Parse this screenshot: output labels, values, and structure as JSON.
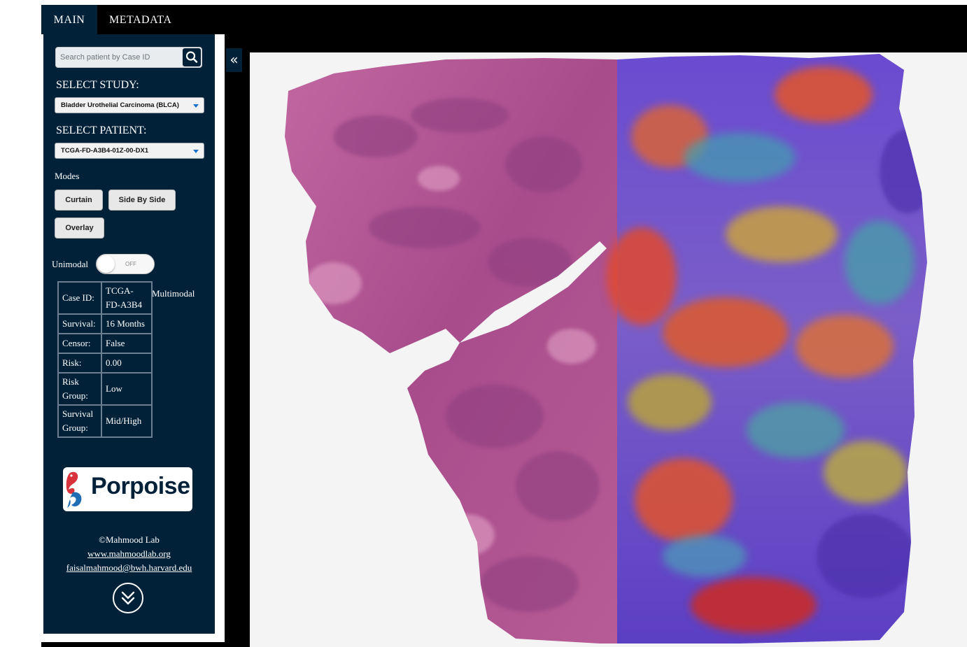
{
  "tabs": [
    {
      "label": "MAIN",
      "active": true
    },
    {
      "label": "METADATA",
      "active": false
    }
  ],
  "search": {
    "placeholder": "Search patient by Case ID",
    "icon": "search-icon"
  },
  "study": {
    "label": "SELECT STUDY:",
    "selected": "Bladder Urothelial Carcinoma (BLCA)"
  },
  "patient": {
    "label": "SELECT PATIENT:",
    "selected": "TCGA-FD-A3B4-01Z-00-DX1"
  },
  "modes": {
    "label": "Modes",
    "buttons": [
      "Curtain",
      "Side By Side",
      "Overlay"
    ]
  },
  "toggle": {
    "left_label": "Unimodal",
    "state_text": "OFF",
    "right_label": "Multimodal",
    "on": false
  },
  "info_table": [
    {
      "key": "Case ID:",
      "value": "TCGA-FD-A3B4"
    },
    {
      "key": "Survival:",
      "value": "16 Months"
    },
    {
      "key": "Censor:",
      "value": "False"
    },
    {
      "key": "Risk:",
      "value": "0.00"
    },
    {
      "key": "Risk Group:",
      "value": "Low"
    },
    {
      "key": "Survival Group:",
      "value": "Mid/High"
    }
  ],
  "logo": {
    "text": "Porpoise"
  },
  "footer": {
    "copyright": "©Mahmood Lab",
    "website": "www.mahmoodlab.org",
    "email": "faisalmahmood@bwh.harvard.edu"
  },
  "icons": {
    "collapse": "double-chevron-left-icon",
    "scroll_down": "double-chevron-down-icon"
  },
  "colors": {
    "sidebar_bg": "#012139",
    "tissue_he": "#b5558f",
    "heatmap_low": "#5a3fc0",
    "heatmap_high": "#e03a2a"
  }
}
